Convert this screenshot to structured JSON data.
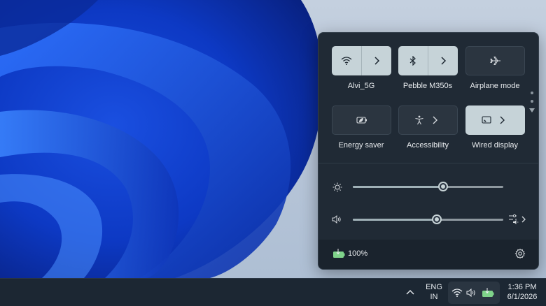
{
  "quick_settings": {
    "tiles": [
      {
        "label": "Alvi_5G",
        "icon": "wifi-icon",
        "state": "on",
        "expandable": true
      },
      {
        "label": "Pebble M350s",
        "icon": "bluetooth-icon",
        "state": "on",
        "expandable": true
      },
      {
        "label": "Airplane mode",
        "icon": "airplane-icon",
        "state": "off",
        "expandable": false
      },
      {
        "label": "Energy saver",
        "icon": "energy-saver-icon",
        "state": "off",
        "expandable": false
      },
      {
        "label": "Accessibility",
        "icon": "accessibility-icon",
        "state": "off",
        "expandable": true
      },
      {
        "label": "Wired display",
        "icon": "cast-icon",
        "state": "on",
        "expandable": true
      }
    ],
    "brightness_level": 0.6,
    "volume_level": 0.56,
    "battery_percent": "100%",
    "page_dots": 2
  },
  "taskbar": {
    "language_line1": "ENG",
    "language_line2": "IN",
    "time": "1:36 PM",
    "date": "6/1/2026"
  },
  "colors": {
    "panel_bg": "#202a35",
    "tile_on": "#c6d3d8",
    "battery_green": "#7fd38a"
  }
}
